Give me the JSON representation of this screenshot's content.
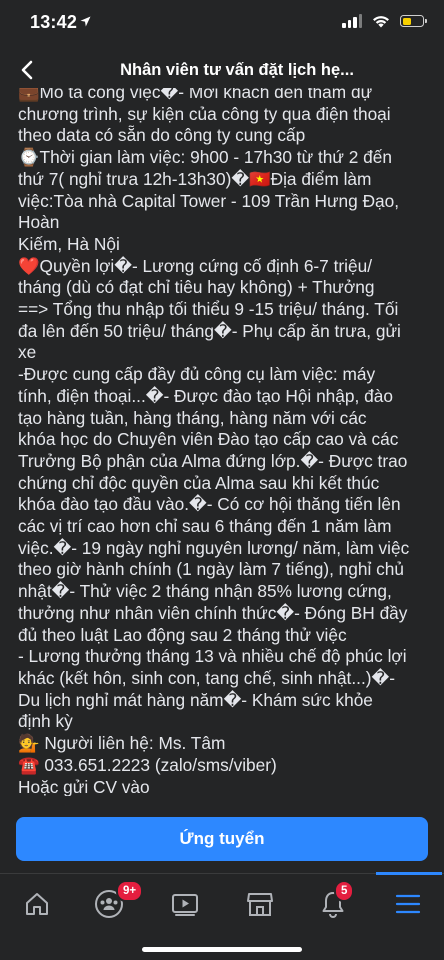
{
  "status": {
    "time": "13:42"
  },
  "header": {
    "title": "Nhân viên tư vấn đặt lịch hẹ..."
  },
  "post": {
    "lines": [
      "💼Mô tả công việc�- Mời khách đến tham dự",
      "chương trình, sự kiện của công ty qua điện thoại",
      "theo data có sẵn do công ty cung cấp",
      "⌚Thời gian làm việc: 9h00 - 17h30 từ thứ 2 đến",
      "thứ 7( nghỉ trưa 12h-13h30)�🇻🇳Địa điểm làm",
      "việc:Tòa nhà Capital Tower - 109 Trần Hưng Đạo,",
      "Hoàn",
      "Kiếm, Hà Nội",
      "❤️Quyền lợi�- Lương cứng cố định 6-7 triệu/",
      "tháng (dù có đạt chỉ tiêu hay không) + Thưởng",
      "==> Tổng thu nhập tối thiểu 9 -15 triệu/ tháng. Tối",
      "đa lên đến 50 triệu/ tháng�- Phụ cấp ăn trưa, gửi",
      "xe",
      "-Được cung cấp đầy đủ công cụ làm việc: máy",
      "tính, điện thoại...�- Được đào tạo Hội nhập, đào",
      "tạo hàng tuần, hàng tháng, hàng năm với các",
      "khóa học do Chuyên viên Đào tạo cấp cao và các",
      "Trưởng Bộ phận của Alma đứng lớp.�- Được trao",
      "chứng chỉ độc quyền của Alma sau khi kết thúc",
      "khóa đào tạo đầu vào.�- Có cơ hội thăng tiến lên",
      "các vị trí cao hơn chỉ sau 6 tháng đến 1 năm làm",
      "việc.�- 19 ngày nghỉ nguyên lương/ năm, làm việc",
      "theo giờ hành chính (1 ngày làm 7 tiếng), nghỉ chủ",
      "nhật�- Thử việc 2 tháng nhận 85% lương cứng,",
      "thưởng như nhân viên chính thức�- Đóng BH đầy",
      "đủ theo luật Lao động sau 2 tháng thử việc",
      "- Lương thưởng tháng 13 và nhiều chế độ phúc lợi",
      "khác (kết hôn, sinh con, tang chế, sinh nhật...)�-",
      "Du lịch nghỉ mát hàng năm�- Khám sức khỏe",
      "định kỳ",
      "💁 Người liên hệ: Ms. Tâm",
      "☎️ 033.651.2223 (zalo/sms/viber)",
      "Hoặc gửi CV vào"
    ]
  },
  "apply": {
    "label": "Ứng tuyển"
  },
  "nav": {
    "items": [
      {
        "name": "home",
        "icon": "home-icon"
      },
      {
        "name": "groups",
        "icon": "groups-icon",
        "badge": "9+"
      },
      {
        "name": "watch",
        "icon": "video-play-icon"
      },
      {
        "name": "marketplace",
        "icon": "store-icon"
      },
      {
        "name": "notifications",
        "icon": "bell-icon",
        "badge": "5"
      },
      {
        "name": "menu",
        "icon": "hamburger-menu-icon",
        "active": true
      }
    ]
  },
  "colors": {
    "accent": "#2d88ff",
    "background": "#242526",
    "badge": "#e41e3f",
    "text": "#e4e6eb"
  }
}
